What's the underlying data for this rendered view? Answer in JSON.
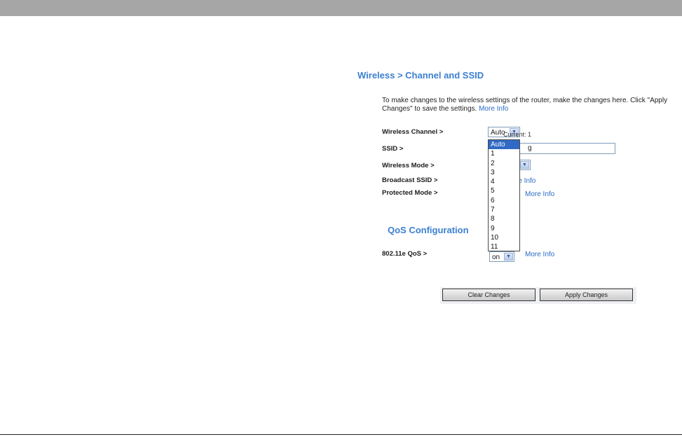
{
  "page": {
    "title": "Wireless > Channel and SSID",
    "description": "To make changes to the wireless settings of the router, make the changes here. Click \"Apply Changes\" to save the settings.",
    "more_info": "More Info"
  },
  "form": {
    "wireless_channel": {
      "label": "Wireless Channel >",
      "value": "Auto",
      "current": "Current: 1"
    },
    "ssid": {
      "label": "SSID >",
      "value_fragment": "g"
    },
    "wireless_mode": {
      "label": "Wireless Mode >"
    },
    "broadcast_ssid": {
      "label": "Broadcast SSID >",
      "more_info_fragment": "re Info"
    },
    "protected_mode": {
      "label": "Protected Mode >",
      "more_info": "More Info"
    }
  },
  "channel_options": [
    "Auto",
    "1",
    "2",
    "3",
    "4",
    "5",
    "6",
    "7",
    "8",
    "9",
    "10",
    "11"
  ],
  "qos": {
    "title": "QoS Configuration",
    "label": "802.11e QoS >",
    "value": "on",
    "more_info": "More Info"
  },
  "buttons": {
    "clear": "Clear Changes",
    "apply": "Apply Changes"
  },
  "colors": {
    "accent": "#3b7fd0",
    "link": "#2a6bc4",
    "selection": "#316ac5"
  }
}
